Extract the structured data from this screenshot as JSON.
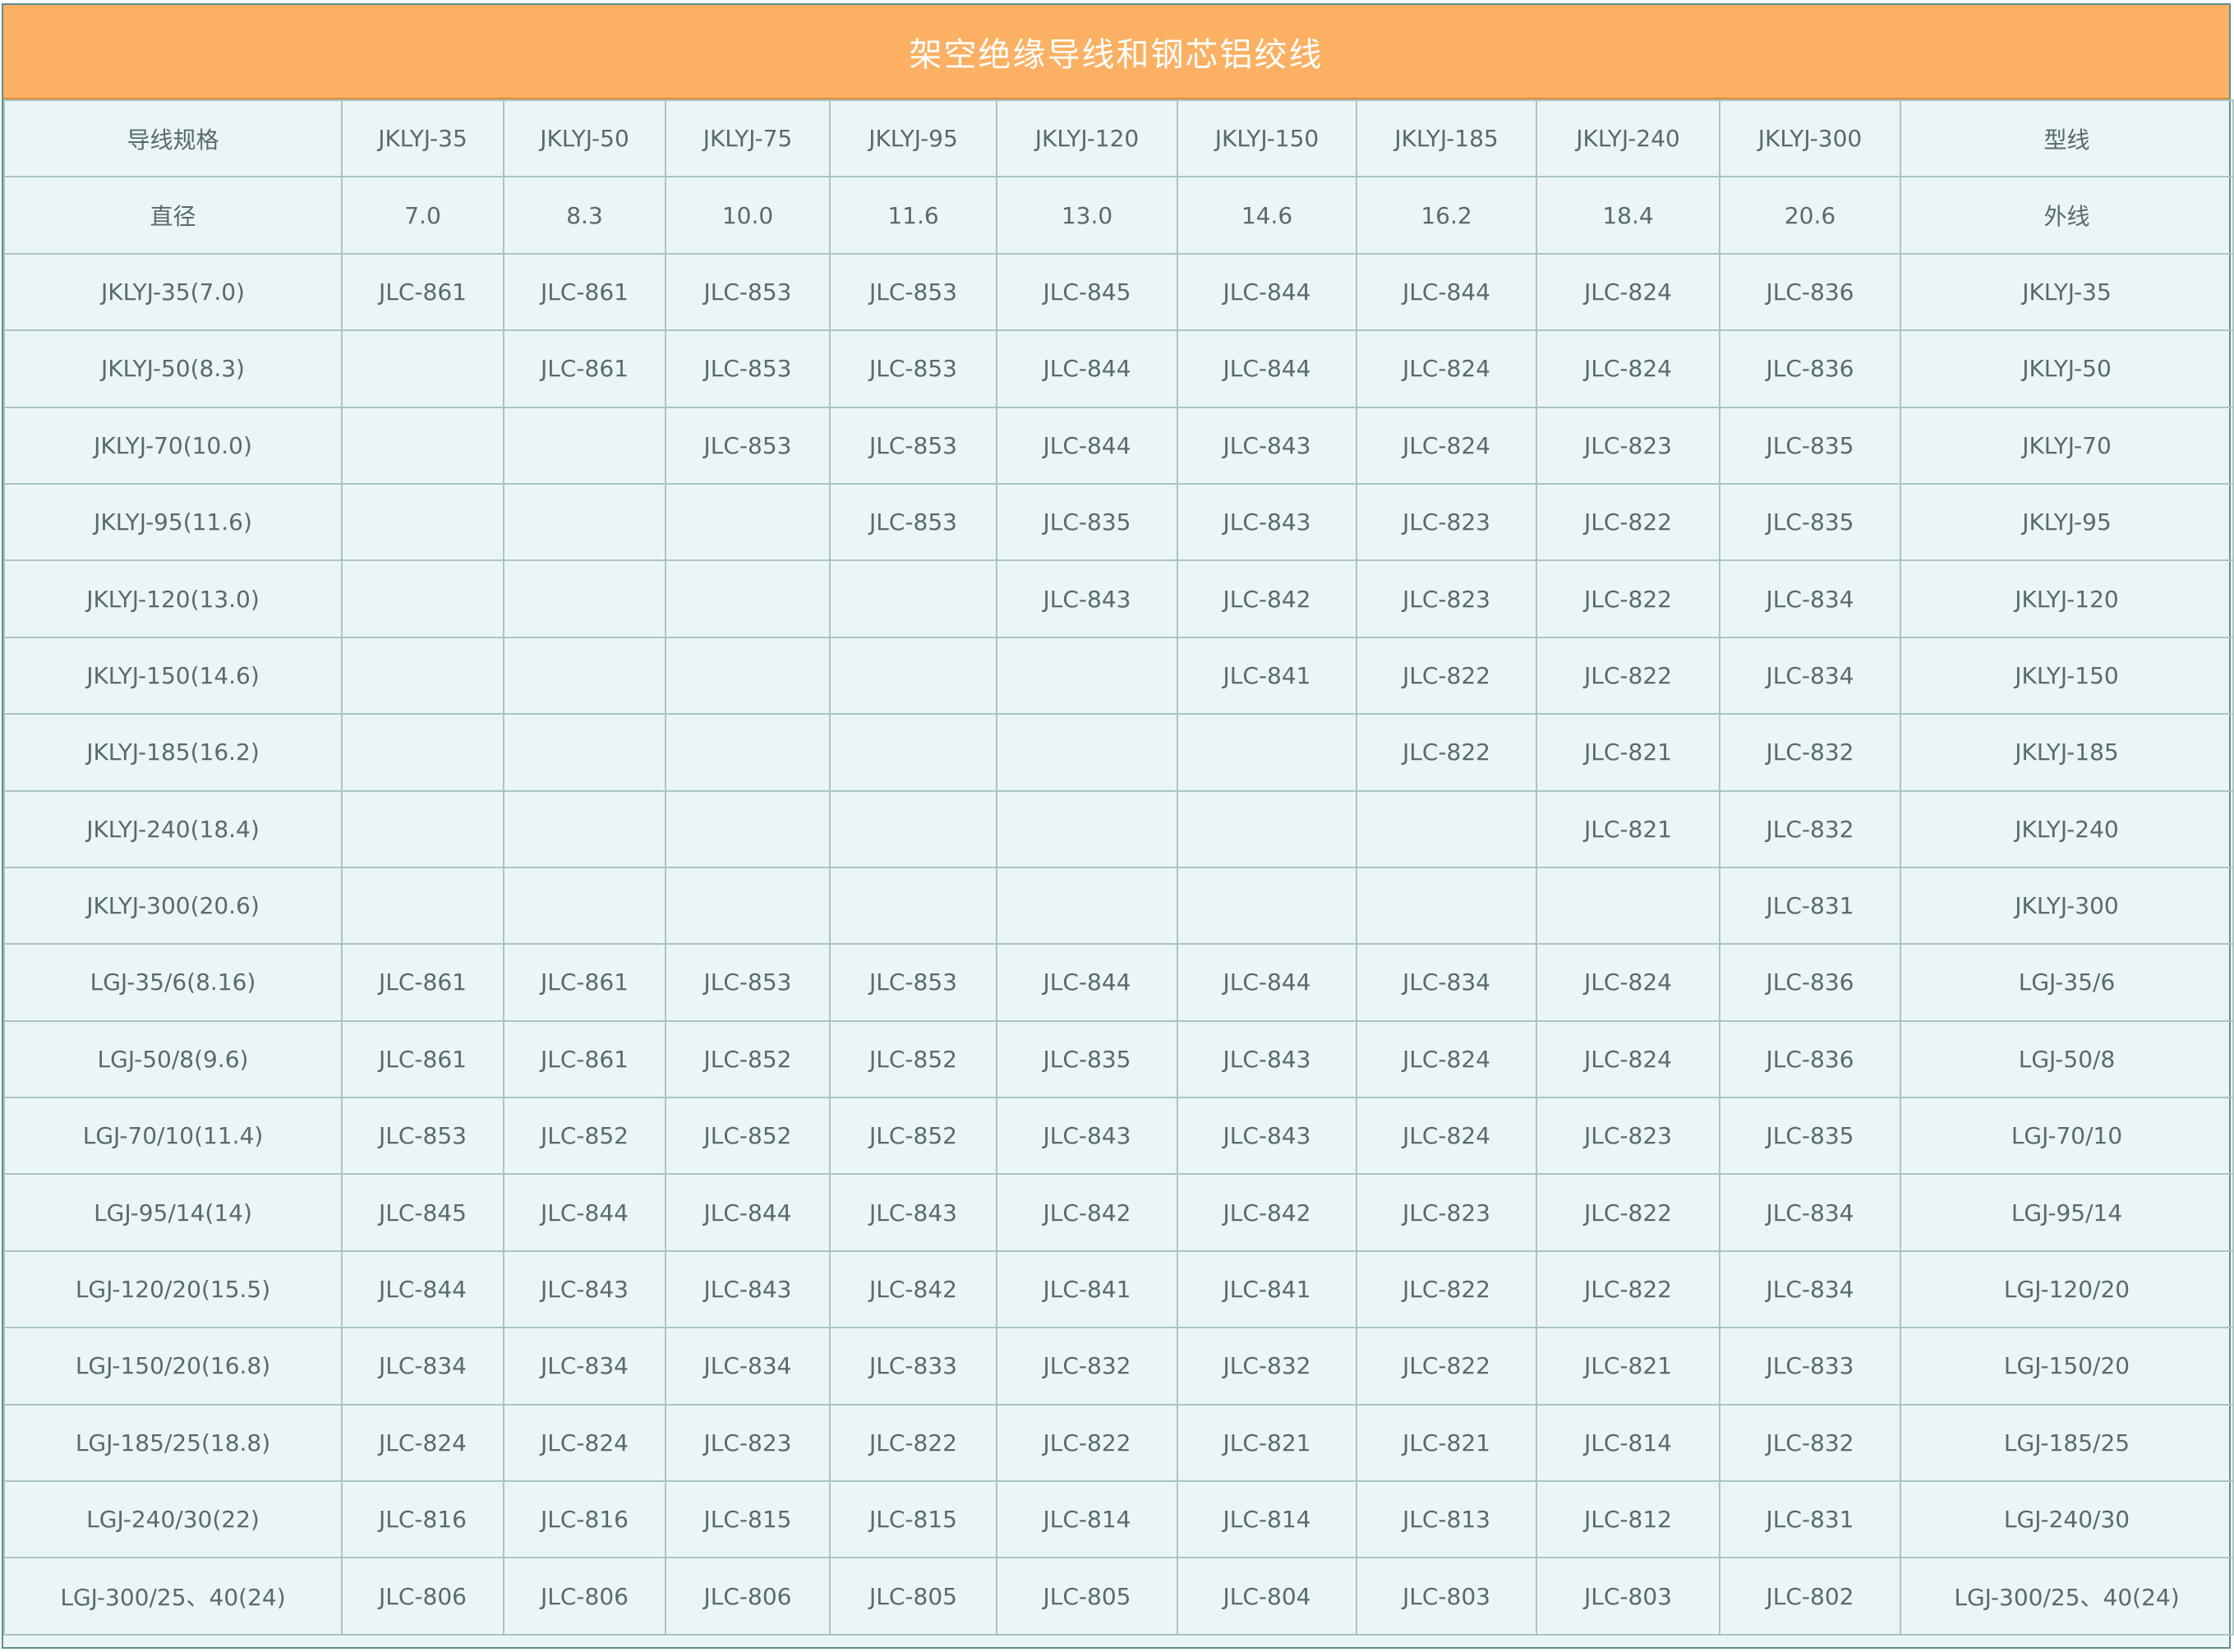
{
  "title": "架空绝缘导线和钢芯铝绞线",
  "header": [
    "导线规格",
    "JKLYJ-35",
    "JKLYJ-50",
    "JKLYJ-75",
    "JKLYJ-95",
    "JKLYJ-120",
    "JKLYJ-150",
    "JKLYJ-185",
    "JKLYJ-240",
    "JKLYJ-300",
    "型线"
  ],
  "rows": [
    [
      "直径",
      "7.0",
      "8.3",
      "10.0",
      "11.6",
      "13.0",
      "14.6",
      "16.2",
      "18.4",
      "20.6",
      "外线"
    ],
    [
      "JKLYJ-35(7.0)",
      "JLC-861",
      "JLC-861",
      "JLC-853",
      "JLC-853",
      "JLC-845",
      "JLC-844",
      "JLC-844",
      "JLC-824",
      "JLC-836",
      "JKLYJ-35"
    ],
    [
      "JKLYJ-50(8.3)",
      "",
      "JLC-861",
      "JLC-853",
      "JLC-853",
      "JLC-844",
      "JLC-844",
      "JLC-824",
      "JLC-824",
      "JLC-836",
      "JKLYJ-50"
    ],
    [
      "JKLYJ-70(10.0)",
      "",
      "",
      "JLC-853",
      "JLC-853",
      "JLC-844",
      "JLC-843",
      "JLC-824",
      "JLC-823",
      "JLC-835",
      "JKLYJ-70"
    ],
    [
      "JKLYJ-95(11.6)",
      "",
      "",
      "",
      "JLC-853",
      "JLC-835",
      "JLC-843",
      "JLC-823",
      "JLC-822",
      "JLC-835",
      "JKLYJ-95"
    ],
    [
      "JKLYJ-120(13.0)",
      "",
      "",
      "",
      "",
      "JLC-843",
      "JLC-842",
      "JLC-823",
      "JLC-822",
      "JLC-834",
      "JKLYJ-120"
    ],
    [
      "JKLYJ-150(14.6)",
      "",
      "",
      "",
      "",
      "",
      "JLC-841",
      "JLC-822",
      "JLC-822",
      "JLC-834",
      "JKLYJ-150"
    ],
    [
      "JKLYJ-185(16.2)",
      "",
      "",
      "",
      "",
      "",
      "",
      "JLC-822",
      "JLC-821",
      "JLC-832",
      "JKLYJ-185"
    ],
    [
      "JKLYJ-240(18.4)",
      "",
      "",
      "",
      "",
      "",
      "",
      "",
      "JLC-821",
      "JLC-832",
      "JKLYJ-240"
    ],
    [
      "JKLYJ-300(20.6)",
      "",
      "",
      "",
      "",
      "",
      "",
      "",
      "",
      "JLC-831",
      "JKLYJ-300"
    ],
    [
      "LGJ-35/6(8.16)",
      "JLC-861",
      "JLC-861",
      "JLC-853",
      "JLC-853",
      "JLC-844",
      "JLC-844",
      "JLC-834",
      "JLC-824",
      "JLC-836",
      "LGJ-35/6"
    ],
    [
      "LGJ-50/8(9.6)",
      "JLC-861",
      "JLC-861",
      "JLC-852",
      "JLC-852",
      "JLC-835",
      "JLC-843",
      "JLC-824",
      "JLC-824",
      "JLC-836",
      "LGJ-50/8"
    ],
    [
      "LGJ-70/10(11.4)",
      "JLC-853",
      "JLC-852",
      "JLC-852",
      "JLC-852",
      "JLC-843",
      "JLC-843",
      "JLC-824",
      "JLC-823",
      "JLC-835",
      "LGJ-70/10"
    ],
    [
      "LGJ-95/14(14)",
      "JLC-845",
      "JLC-844",
      "JLC-844",
      "JLC-843",
      "JLC-842",
      "JLC-842",
      "JLC-823",
      "JLC-822",
      "JLC-834",
      "LGJ-95/14"
    ],
    [
      "LGJ-120/20(15.5)",
      "JLC-844",
      "JLC-843",
      "JLC-843",
      "JLC-842",
      "JLC-841",
      "JLC-841",
      "JLC-822",
      "JLC-822",
      "JLC-834",
      "LGJ-120/20"
    ],
    [
      "LGJ-150/20(16.8)",
      "JLC-834",
      "JLC-834",
      "JLC-834",
      "JLC-833",
      "JLC-832",
      "JLC-832",
      "JLC-822",
      "JLC-821",
      "JLC-833",
      "LGJ-150/20"
    ],
    [
      "LGJ-185/25(18.8)",
      "JLC-824",
      "JLC-824",
      "JLC-823",
      "JLC-822",
      "JLC-822",
      "JLC-821",
      "JLC-821",
      "JLC-814",
      "JLC-832",
      "LGJ-185/25"
    ],
    [
      "LGJ-240/30(22)",
      "JLC-816",
      "JLC-816",
      "JLC-815",
      "JLC-815",
      "JLC-814",
      "JLC-814",
      "JLC-813",
      "JLC-812",
      "JLC-831",
      "LGJ-240/30"
    ],
    [
      "LGJ-300/25、40(24)",
      "JLC-806",
      "JLC-806",
      "JLC-806",
      "JLC-805",
      "JLC-805",
      "JLC-804",
      "JLC-803",
      "JLC-803",
      "JLC-802",
      "LGJ-300/25、40(24)"
    ]
  ],
  "colors": {
    "title_bg": "#fbb063",
    "title_text": "#ffffff",
    "sheet_bg": "#ecf5f5",
    "grid_line": "#a9c4c4",
    "cell_text": "#596a6a"
  }
}
